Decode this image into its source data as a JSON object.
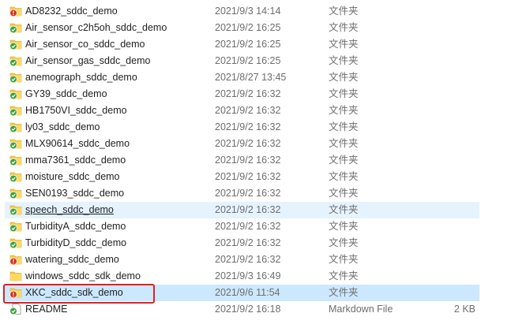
{
  "files": [
    {
      "name": "AD8232_sddc_demo",
      "date": "2021/9/3 14:14",
      "type": "文件夹",
      "size": "",
      "status": "error"
    },
    {
      "name": "Air_sensor_c2h5oh_sddc_demo",
      "date": "2021/9/2 16:25",
      "type": "文件夹",
      "size": "",
      "status": "ok"
    },
    {
      "name": "Air_sensor_co_sddc_demo",
      "date": "2021/9/2 16:25",
      "type": "文件夹",
      "size": "",
      "status": "ok"
    },
    {
      "name": "Air_sensor_gas_sddc_demo",
      "date": "2021/9/2 16:25",
      "type": "文件夹",
      "size": "",
      "status": "ok"
    },
    {
      "name": "anemograph_sddc_demo",
      "date": "2021/8/27 13:45",
      "type": "文件夹",
      "size": "",
      "status": "ok"
    },
    {
      "name": "GY39_sddc_demo",
      "date": "2021/9/2 16:32",
      "type": "文件夹",
      "size": "",
      "status": "ok"
    },
    {
      "name": "HB1750VI_sddc_demo",
      "date": "2021/9/2 16:32",
      "type": "文件夹",
      "size": "",
      "status": "ok"
    },
    {
      "name": "ly03_sddc_demo",
      "date": "2021/9/2 16:32",
      "type": "文件夹",
      "size": "",
      "status": "ok"
    },
    {
      "name": "MLX90614_sddc_demo",
      "date": "2021/9/2 16:32",
      "type": "文件夹",
      "size": "",
      "status": "ok"
    },
    {
      "name": "mma7361_sddc_demo",
      "date": "2021/9/2 16:32",
      "type": "文件夹",
      "size": "",
      "status": "ok"
    },
    {
      "name": "moisture_sddc_demo",
      "date": "2021/9/2 16:32",
      "type": "文件夹",
      "size": "",
      "status": "ok"
    },
    {
      "name": "SEN0193_sddc_demo",
      "date": "2021/9/2 16:32",
      "type": "文件夹",
      "size": "",
      "status": "ok"
    },
    {
      "name": "speech_sddc_demo",
      "date": "2021/9/2 16:32",
      "type": "文件夹",
      "size": "",
      "status": "ok"
    },
    {
      "name": "TurbidityA_sddc_demo",
      "date": "2021/9/2 16:32",
      "type": "文件夹",
      "size": "",
      "status": "ok"
    },
    {
      "name": "TurbidityD_sddc_demo",
      "date": "2021/9/2 16:32",
      "type": "文件夹",
      "size": "",
      "status": "ok"
    },
    {
      "name": "watering_sddc_demo",
      "date": "2021/9/2 16:32",
      "type": "文件夹",
      "size": "",
      "status": "error"
    },
    {
      "name": "windows_sddc_sdk_demo",
      "date": "2021/9/3 16:49",
      "type": "文件夹",
      "size": "",
      "status": "none"
    },
    {
      "name": "XKC_sddc_sdk_demo",
      "date": "2021/9/6 11:54",
      "type": "文件夹",
      "size": "",
      "status": "error"
    },
    {
      "name": "README",
      "date": "2021/9/2 16:18",
      "type": "Markdown File",
      "size": "2 KB",
      "status": "ok-file"
    }
  ],
  "colors": {
    "ok": "#3fa142",
    "error": "#d9331f",
    "folder": "#f5c748",
    "highlight_border": "#e02020",
    "selected": "#cce8ff",
    "hover": "#e5f3ff"
  }
}
